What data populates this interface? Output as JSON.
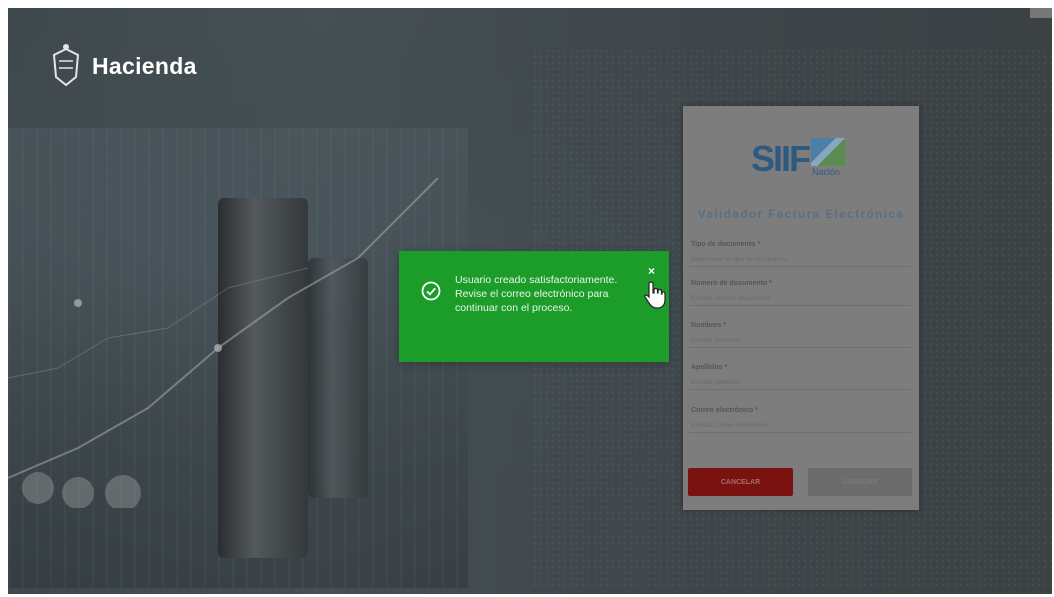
{
  "brand": {
    "name": "Hacienda"
  },
  "form": {
    "logo_text": "SIIF",
    "logo_sub": "Nación",
    "title": "Validador Factura Electrónica",
    "fields": [
      {
        "label": "Tipo de documento *",
        "placeholder": "Seleccione un tipo de documento"
      },
      {
        "label": "Número de documento *",
        "placeholder": "Escriba número documento"
      },
      {
        "label": "Nombres *",
        "placeholder": "Escriba Nombres"
      },
      {
        "label": "Apellidos *",
        "placeholder": "Escriba Apellidos"
      },
      {
        "label": "Correo electrónico *",
        "placeholder": "Escriba Correo Electrónico"
      }
    ],
    "cancel_label": "CANCELAR",
    "save_label": "GUARDAR"
  },
  "toast": {
    "message": "Usuario creado satisfactoriamente. Revise el correo electrónico para continuar con el proceso.",
    "close_symbol": "×",
    "status_icon": "check-circle-icon",
    "color": "#1c9d29"
  },
  "colors": {
    "cancel": "#7a1212",
    "title": "#5a6f82"
  }
}
